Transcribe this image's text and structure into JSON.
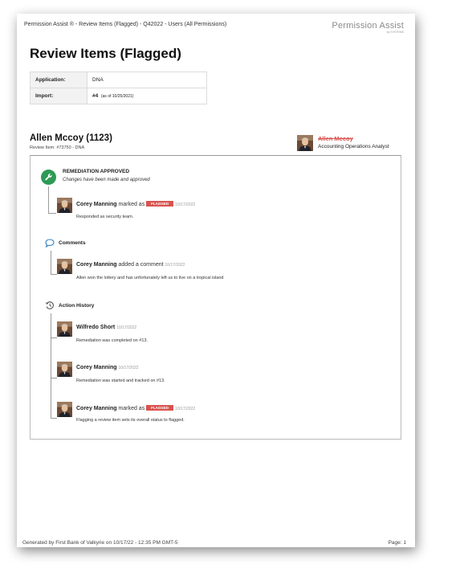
{
  "header": {
    "left_text": "Permission Assist ® - Review Items (Flagged) - Q42022 - Users (All Permissions)",
    "brand_name": "Permission Assist",
    "brand_sub": "by SYSTEMS"
  },
  "title": "Review Items (Flagged)",
  "meta": [
    {
      "key": "Application:",
      "value": "DNA",
      "note": ""
    },
    {
      "key": "Import:",
      "value": "#4",
      "note": "(as of 10/25/2021)"
    }
  ],
  "person": {
    "name": "Allen Mccoy (1123)",
    "sub": "Review Item: #73750 - DNA"
  },
  "manager": {
    "name": "Allen Mccoy",
    "title": "Accounting Operations Analyst"
  },
  "remediation": {
    "title": "REMEDIATION APPROVED",
    "subtitle": "Changes have been made and approved",
    "entry": {
      "who": "Corey Manning",
      "action": "marked as",
      "badge": "FLAGGED",
      "date": "10/17/2022",
      "text": "Responded as security team."
    }
  },
  "comments": {
    "title": "Comments",
    "entry": {
      "who": "Corey Manning",
      "action": "added a comment",
      "date": "10/17/2022",
      "text": "Allen won the lottery and has unfortunately left us to live on a tropical island"
    }
  },
  "history": {
    "title": "Action History",
    "entries": [
      {
        "who": "Wilfredo Short",
        "action": "",
        "badge": "",
        "date": "10/17/2022",
        "text": "Remediation was completed on #13."
      },
      {
        "who": "Corey Manning",
        "action": "",
        "badge": "",
        "date": "10/17/2022",
        "text": "Remediation was started and tracked on #13."
      },
      {
        "who": "Corey Manning",
        "action": "marked as",
        "badge": "FLAGGED",
        "date": "10/17/2022",
        "text": "Flagging a review item sets its overall status to flagged."
      }
    ]
  },
  "footer": {
    "left": "Generated by First Bank of Valkyrie on 10/17/22 - 12:35 PM GMT-5",
    "right": "Page: 1"
  },
  "colors": {
    "flag_red": "#d9534f",
    "success_green": "#2e9a56",
    "comment_blue": "#2f7fc1"
  }
}
